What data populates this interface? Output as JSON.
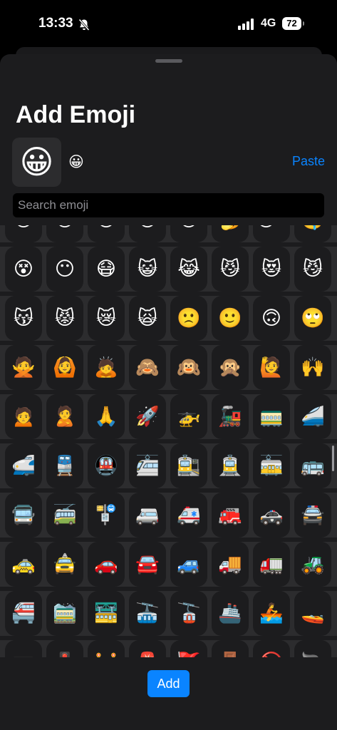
{
  "status_bar": {
    "time": "13:33",
    "silent_icon": "bell-slash-icon",
    "signal_icon": "cellular-signal-icon",
    "network": "4G",
    "battery": "72"
  },
  "sheet": {
    "title": "Add Emoji",
    "selected_emoji": "😀",
    "selected_emoji_small": "😀",
    "paste_label": "Paste",
    "search_placeholder": "Search emoji",
    "search_value": "",
    "add_label": "Add"
  },
  "colors": {
    "accent": "#0a84ff",
    "sheet_bg": "#1c1c1e",
    "cell_bg": "#2c2c2e"
  },
  "emoji_rows": [
    [
      "😯",
      "😦",
      "😧",
      "😮",
      "😲",
      "🥱",
      "😴",
      "🤤"
    ],
    [
      "😵",
      "😶",
      "😷",
      "😺",
      "😹",
      "😼",
      "😻",
      "😼"
    ],
    [
      "😽",
      "😾",
      "😿",
      "🙀",
      "🙁",
      "🙂",
      "🙃",
      "🙄"
    ],
    [
      "🙅",
      "🙆",
      "🙇",
      "🙈",
      "🙉",
      "🙊",
      "🙋",
      "🙌"
    ],
    [
      "🙍",
      "🙎",
      "🙏",
      "🚀",
      "🚁",
      "🚂",
      "🚃",
      "🚄"
    ],
    [
      "🚅",
      "🚆",
      "🚇",
      "🚈",
      "🚉",
      "🚊",
      "🚋",
      "🚌"
    ],
    [
      "🚍",
      "🚎",
      "🚏",
      "🚐",
      "🚑",
      "🚒",
      "🚓",
      "🚔"
    ],
    [
      "🚕",
      "🚖",
      "🚗",
      "🚘",
      "🚙",
      "🚚",
      "🚛",
      "🚜"
    ],
    [
      "🚝",
      "🚞",
      "🚟",
      "🚠",
      "🚡",
      "🚢",
      "🚣",
      "🚤"
    ],
    [
      "🚥",
      "🚦",
      "🚧",
      "🚨",
      "🚩",
      "🚪",
      "🚫",
      "🚬"
    ]
  ]
}
